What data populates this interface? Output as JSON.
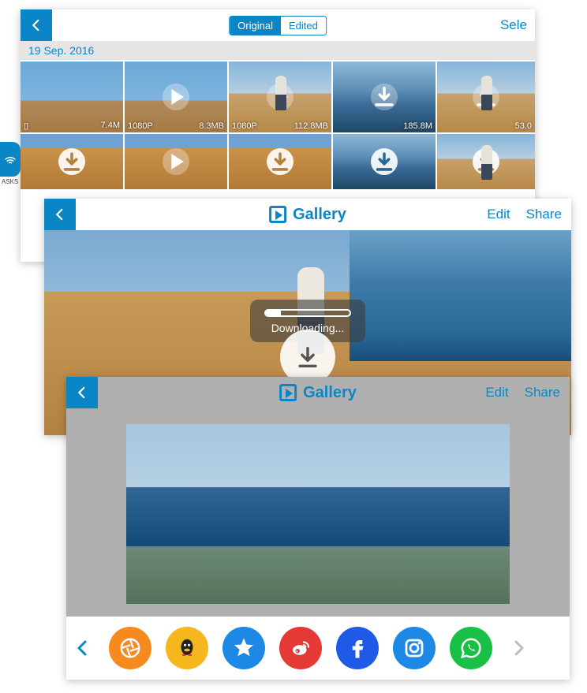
{
  "l1": {
    "seg_original": "Original",
    "seg_edited": "Edited",
    "select": "Sele",
    "date": "19 Sep. 2016",
    "row1": [
      {
        "left": "",
        "right": "7.4M",
        "icon": "phone"
      },
      {
        "left": "1080P",
        "right": "8.3MB",
        "icon": "play"
      },
      {
        "left": "1080P",
        "right": "112.8MB",
        "icon": "play"
      },
      {
        "left": "",
        "right": "185.8M",
        "icon": "download"
      },
      {
        "left": "",
        "right": "53.0",
        "icon": "download"
      }
    ],
    "row2": [
      {
        "icon": "download-solid"
      },
      {
        "icon": "play"
      },
      {
        "icon": "download-solid"
      },
      {
        "icon": "download-solid"
      },
      {
        "icon": "download-solid"
      }
    ],
    "asks": "ASKS"
  },
  "l2": {
    "title": "Gallery",
    "edit": "Edit",
    "share": "Share",
    "downloading": "Downloading..."
  },
  "l3": {
    "title": "Gallery",
    "edit": "Edit",
    "share": "Share",
    "share_targets": [
      "camera",
      "qq",
      "qzone",
      "weibo",
      "facebook",
      "instagram",
      "whatsapp"
    ]
  }
}
